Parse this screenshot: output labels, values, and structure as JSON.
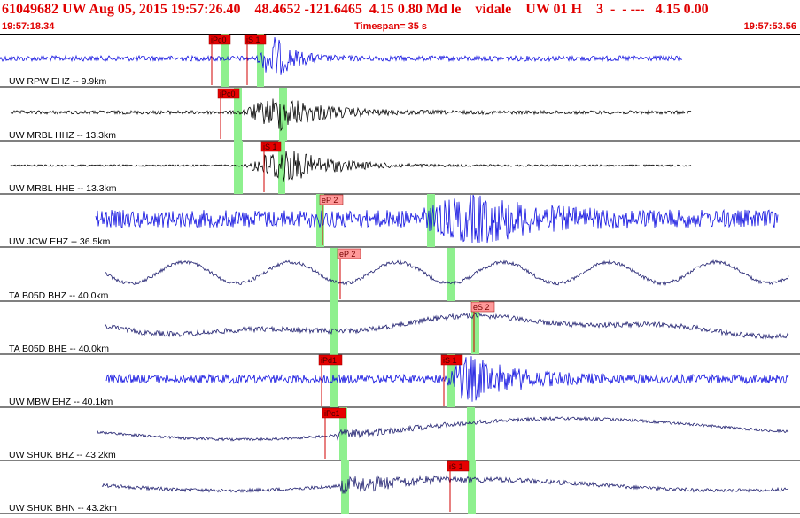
{
  "header": {
    "title": "61049682 UW Aug 05, 2015 19:57:26.40    48.4652 -121.6465  4.15 0.80 Md le    vidale    UW 01 H    3  -  - ---   4.15 0.00",
    "start_time": "19:57:18.34",
    "timespan": "Timespan=  35 s",
    "end_time": "19:57:53.56"
  },
  "colors": {
    "pick_box": "#e60000",
    "pick_box_alt": "#ff9a9a",
    "window_green": "#8ef08e",
    "trace_blue": "#1010e0",
    "trace_black": "#000000",
    "trace_navy": "#202070"
  },
  "traces": [
    {
      "label": "UW RPW EHZ -- 9.9km",
      "picks": [
        "iPc0",
        "iS 1"
      ]
    },
    {
      "label": "UW MRBL HHZ -- 13.3km",
      "picks": [
        "iPc0"
      ]
    },
    {
      "label": "UW MRBL HHE -- 13.3km",
      "picks": [
        "iS 1"
      ]
    },
    {
      "label": "UW JCW EHZ -- 36.5km",
      "picks": [
        "eP 2"
      ]
    },
    {
      "label": "TA B05D BHZ -- 40.0km",
      "picks": [
        "eP 2"
      ]
    },
    {
      "label": "TA B05D BHE -- 40.0km",
      "picks": [
        "eS 2"
      ]
    },
    {
      "label": "UW MBW EHZ -- 40.1km",
      "picks": [
        "iPd1",
        "iS 1"
      ]
    },
    {
      "label": "UW SHUK BHZ -- 43.2km",
      "picks": [
        "iPc1"
      ]
    },
    {
      "label": "UW SHUK BHN -- 43.2km",
      "picks": [
        "iS 1"
      ]
    }
  ]
}
